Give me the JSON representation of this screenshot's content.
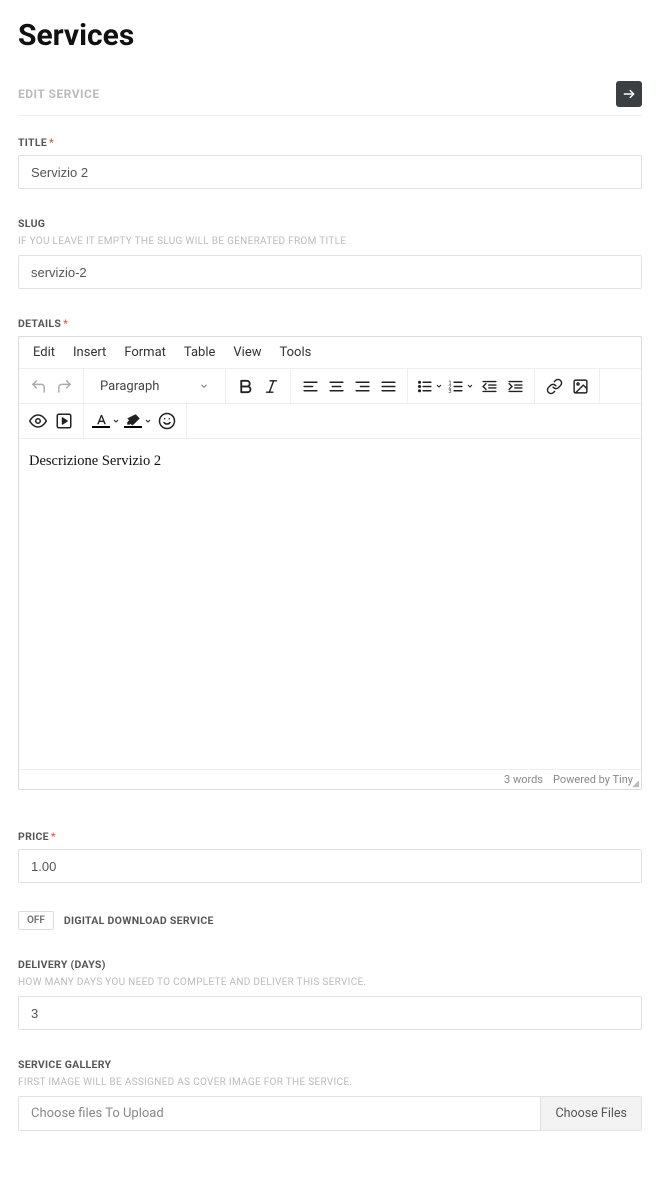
{
  "page_title": "Services",
  "section_label": "EDIT SERVICE",
  "fields": {
    "title": {
      "label": "TITLE",
      "value": "Servizio 2"
    },
    "slug": {
      "label": "SLUG",
      "help": "IF YOU LEAVE IT EMPTY THE SLUG WILL BE GENERATED FROM TITLE",
      "value": "servizio-2"
    },
    "details": {
      "label": "DETAILS",
      "content": "Descrizione Servizio 2"
    },
    "price": {
      "label": "PRICE",
      "value": "1.00"
    },
    "digital_download": {
      "state": "OFF",
      "label": "DIGITAL DOWNLOAD SERVICE"
    },
    "delivery": {
      "label": "DELIVERY (DAYS)",
      "help": "HOW MANY DAYS YOU NEED TO COMPLETE AND DELIVER THIS SERVICE.",
      "value": "3"
    },
    "gallery": {
      "label": "SERVICE GALLERY",
      "help": "FIRST IMAGE WILL BE ASSIGNED AS COVER IMAGE FOR THE SERVICE.",
      "placeholder": "Choose files To Upload",
      "button": "Choose Files"
    }
  },
  "editor": {
    "menu": [
      "Edit",
      "Insert",
      "Format",
      "Table",
      "View",
      "Tools"
    ],
    "block_format": "Paragraph",
    "status_words": "3 words",
    "status_powered": "Powered by Tiny"
  }
}
